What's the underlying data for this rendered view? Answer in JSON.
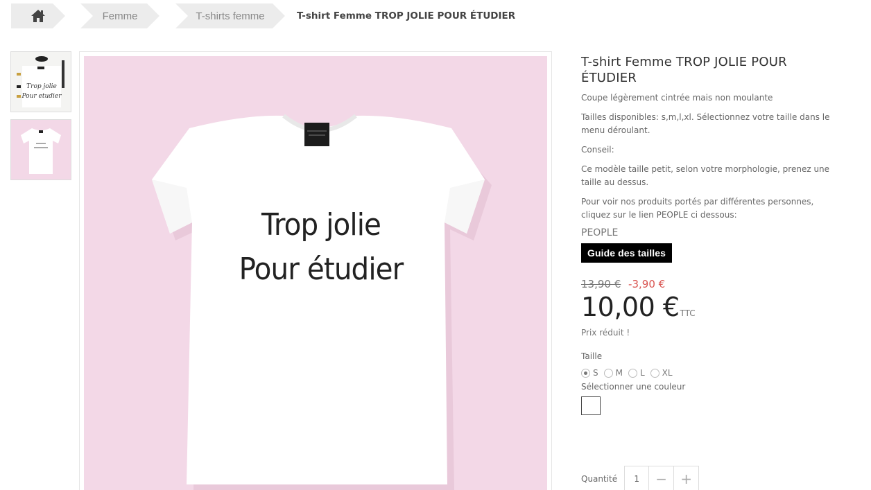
{
  "breadcrumb": {
    "home_icon": "home-icon",
    "items": [
      "Femme",
      "T-shirts femme"
    ],
    "current": "T-shirt Femme TROP JOLIE POUR ÉTUDIER"
  },
  "product": {
    "title": "T-shirt Femme TROP JOLIE POUR ÉTUDIER",
    "description": [
      "Coupe légèrement cintrée mais non moulante",
      "Tailles disponibles: s,m,l,xl. Sélectionnez votre taille dans le menu déroulant.",
      "Conseil:",
      "Ce modèle taille petit, selon votre morphologie, prenez une taille au dessus.",
      "Pour voir nos produits portés par différentes personnes, cliquez sur le lien PEOPLE ci dessous:"
    ],
    "people_link": "PEOPLE",
    "guide_button": "Guide des tailles",
    "old_price": "13,90 €",
    "discount": "-3,90 €",
    "price": "10,00 €",
    "tax_label": "TTC",
    "reduced_label": "Prix réduit !",
    "size_label": "Taille",
    "sizes": [
      "S",
      "M",
      "L",
      "XL"
    ],
    "selected_size": "S",
    "color_label": "Sélectionner une couleur",
    "color_swatch": "#ffffff",
    "quantity_label": "Quantité",
    "quantity_value": "1"
  },
  "images": {
    "shirt_text_line1": "Trop jolie",
    "shirt_text_line2": "Pour étudier",
    "thumb1_text_line1": "Trop jolie",
    "thumb1_text_line2": "Pour etudier",
    "background_color": "#f3d8e7"
  }
}
